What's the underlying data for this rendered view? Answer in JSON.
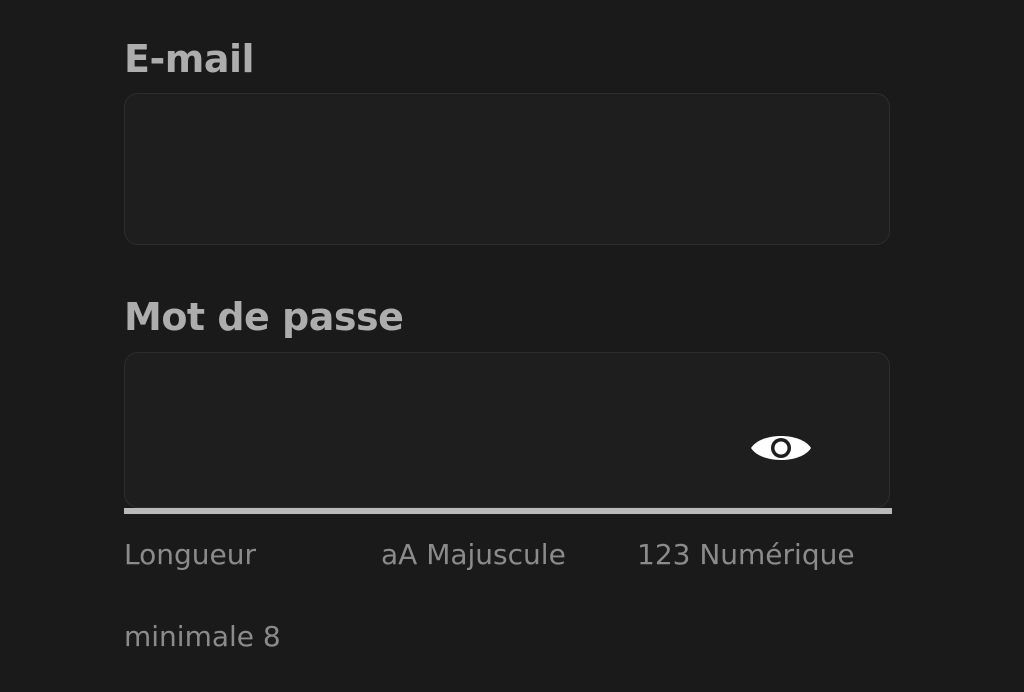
{
  "form": {
    "email": {
      "label": "E-mail",
      "value": "",
      "placeholder": ""
    },
    "password": {
      "label": "Mot de passe",
      "value": "",
      "placeholder": "",
      "toggle_icon": "eye-icon"
    }
  },
  "password_strength": {
    "fraction": 1.0,
    "requirements": {
      "length_line1": "Longueur",
      "length_line2": "minimale 8",
      "uppercase": "aA Majuscule",
      "numeric": "123 Numérique"
    }
  },
  "colors": {
    "background": "#1b1a1a",
    "field_background": "#1f1e1e",
    "label": "#aeadad",
    "hint": "#8c8b8b",
    "strength_fill": "#b9b9b9"
  }
}
